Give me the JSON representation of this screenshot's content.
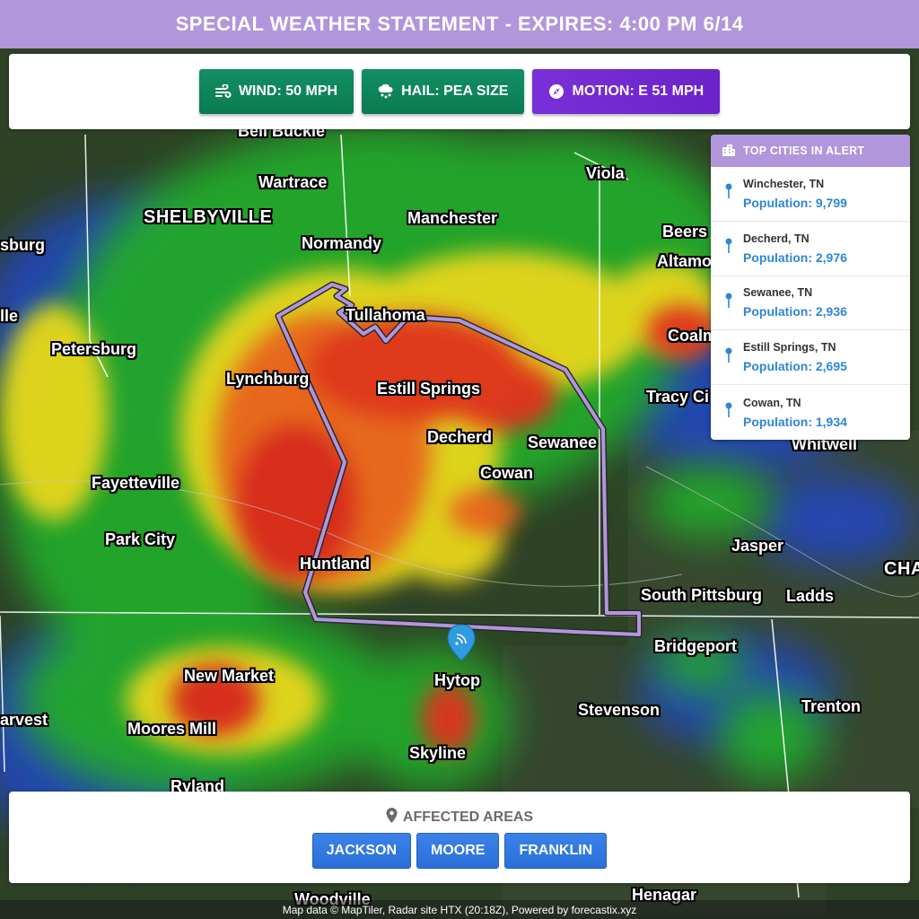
{
  "header": {
    "title": "SPECIAL WEATHER STATEMENT - EXPIRES: 4:00 PM 6/14"
  },
  "chips": [
    {
      "label": "WIND: 50 MPH",
      "icon": "wind-icon",
      "color": "#0f8a5e"
    },
    {
      "label": "HAIL: PEA SIZE",
      "icon": "hail-icon",
      "color": "#0f8a5e"
    },
    {
      "label": "MOTION: E 51 MPH",
      "icon": "compass-icon",
      "color": "#7a30d8"
    }
  ],
  "top_cities": {
    "title": "TOP CITIES IN ALERT",
    "icon": "city-icon",
    "items": [
      {
        "name": "Winchester, TN",
        "population": "Population: 9,799"
      },
      {
        "name": "Decherd, TN",
        "population": "Population: 2,976"
      },
      {
        "name": "Sewanee, TN",
        "population": "Population: 2,936"
      },
      {
        "name": "Estill Springs, TN",
        "population": "Population: 2,695"
      },
      {
        "name": "Cowan, TN",
        "population": "Population: 1,934"
      }
    ]
  },
  "affected_areas": {
    "title": "AFFECTED AREAS",
    "icon": "location-pin-icon",
    "counties": [
      "JACKSON",
      "MOORE",
      "FRANKLIN"
    ]
  },
  "map": {
    "labels": [
      "Bell Buckle",
      "Wartrace",
      "SHELBYVILLE",
      "Normandy",
      "Manchester",
      "Viola",
      "Beers",
      "Altamo",
      "Coalm",
      "Tracy Ci",
      "Whitwell",
      "sburg",
      "lle",
      "Petersburg",
      "Lynchburg",
      "Tullahoma",
      "Estill Springs",
      "Decherd",
      "Sewanee",
      "Cowan",
      "Fayetteville",
      "Park City",
      "Huntland",
      "Jasper",
      "CHA",
      "South Pittsburg",
      "Ladds",
      "Bridgeport",
      "New Market",
      "Hytop",
      "arvest",
      "Moores Mill",
      "Stevenson",
      "Trenton",
      "Skyline",
      "Ryland",
      "Woodville",
      "Henagar"
    ],
    "polygon_color": "#b196dc"
  },
  "attribution": "Map data © MapTiler, Radar site HTX (20:18Z), Powered by forecastix.xyz"
}
